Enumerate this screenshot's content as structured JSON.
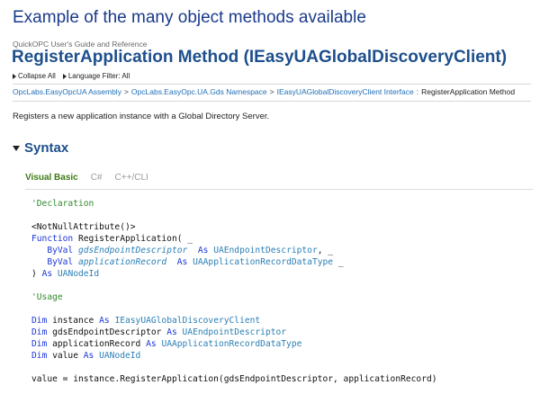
{
  "banner": "Example of the many object methods available",
  "guide_label": "QuickOPC User's Guide and Reference",
  "page_title": "RegisterApplication Method (IEasyUAGlobalDiscoveryClient)",
  "toolbar": {
    "collapse_all": "Collapse All",
    "language_filter": "Language Filter: All"
  },
  "breadcrumb": {
    "assembly": "OpcLabs.EasyOpcUA Assembly",
    "namespace": "OpcLabs.EasyOpc.UA.Gds Namespace",
    "interface": "IEasyUAGlobalDiscoveryClient Interface",
    "separator": ">",
    "separator_last": ":",
    "current": "RegisterApplication Method"
  },
  "summary": "Registers a new application instance with a Global Directory Server.",
  "syntax_heading": "Syntax",
  "tabs": [
    {
      "label": "Visual Basic",
      "active": true
    },
    {
      "label": "C#",
      "active": false
    },
    {
      "label": "C++/CLI",
      "active": false
    }
  ],
  "code": {
    "declaration_comment": "'Declaration",
    "attribute": "<NotNullAttribute()>",
    "kw_function": "Function",
    "func_open": " RegisterApplication( _",
    "kw_byval": "ByVal",
    "param1": "gdsEndpointDescriptor",
    "kw_as": "As",
    "type1": "UAEndpointDescriptor",
    "line_cont": ", _",
    "param2": "applicationRecord",
    "type2": "UAApplicationRecordDataType",
    "cont2": " _",
    "close_paren": ")",
    "return_type": "UANodeId",
    "usage_comment": "'Usage",
    "kw_dim": "Dim",
    "var1": "instance",
    "usage_type1": "IEasyUAGlobalDiscoveryClient",
    "var2": "gdsEndpointDescriptor",
    "usage_type2": "UAEndpointDescriptor",
    "var3": "applicationRecord",
    "usage_type3": "UAApplicationRecordDataType",
    "var4": "value",
    "usage_type4": "UANodeId",
    "call_line": "value = instance.RegisterApplication(gdsEndpointDescriptor, applicationRecord)"
  },
  "colors": {
    "title": "#1d4f8c",
    "keyword": "#1a36d6",
    "comment": "#2e8b2e",
    "type": "#2b7fb5",
    "active_tab": "#3d7a15"
  }
}
